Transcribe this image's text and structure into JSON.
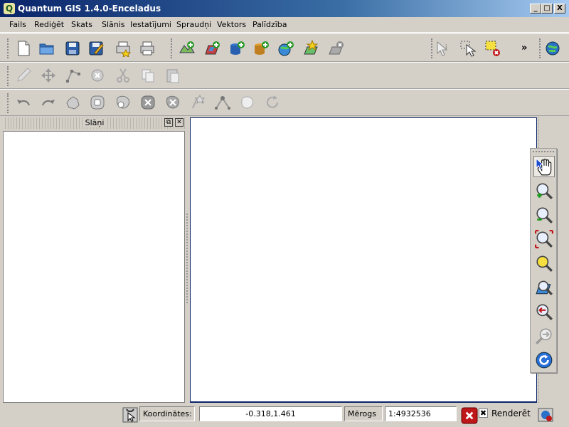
{
  "window": {
    "title": "Quantum GIS 1.4.0-Enceladus",
    "app_icon_glyph": "Q"
  },
  "window_controls": {
    "minimize": "_",
    "maximize": "□",
    "close": "X"
  },
  "menu": [
    "Fails",
    "Rediģēt",
    "Skats",
    "Slānis",
    "Iestatījumi",
    "Spraudņi",
    "Vektors",
    "Palīdzība"
  ],
  "toolbar_overflow": "»",
  "icons": {
    "file_toolbar": [
      "new-project-icon",
      "open-project-icon",
      "save-project-icon",
      "save-as-icon",
      "print-composer-icon",
      "print-icon"
    ],
    "layer_toolbar": [
      "add-vector-layer-icon",
      "add-raster-layer-icon",
      "add-postgis-layer-icon",
      "add-spatialite-layer-icon",
      "add-wms-layer-icon",
      "new-shapefile-icon",
      "remove-layer-icon"
    ],
    "identify_toolbar": [
      "identify-icon",
      "select-icon",
      "deselect-icon"
    ],
    "digitize_toolbar": [
      "toggle-edit-icon",
      "move-feature-icon",
      "node-tool-icon",
      "delete-selected-icon",
      "cut-features-icon",
      "copy-features-icon",
      "paste-features-icon"
    ],
    "advanced_toolbar": [
      "undo-icon",
      "redo-icon",
      "simplify-feature-icon",
      "add-ring-icon",
      "add-part-icon",
      "delete-ring-icon",
      "delete-part-icon",
      "reshape-feature-icon",
      "split-features-icon",
      "merge-features-icon",
      "rotate-point-symbols-icon"
    ],
    "map_nav_toolbar": [
      "pan-icon",
      "zoom-in-icon",
      "zoom-out-icon",
      "zoom-full-icon",
      "zoom-to-selection-icon",
      "zoom-to-layer-icon",
      "zoom-last-icon",
      "zoom-next-icon",
      "refresh-icon"
    ]
  },
  "layers_panel": {
    "title": "Slāņi"
  },
  "statusbar": {
    "coordinates_label": "Koordinātes:",
    "coordinates_value": "-0.318,1.461",
    "scale_label": "Mērogs",
    "scale_value": "1:4932536",
    "render_label": "Renderēt",
    "render_checked": true
  },
  "colors": {
    "titlebar": "#0a246a",
    "chrome": "#d4d0c8",
    "canvas_border": "#0a246a",
    "stop_red": "#c0181a"
  }
}
